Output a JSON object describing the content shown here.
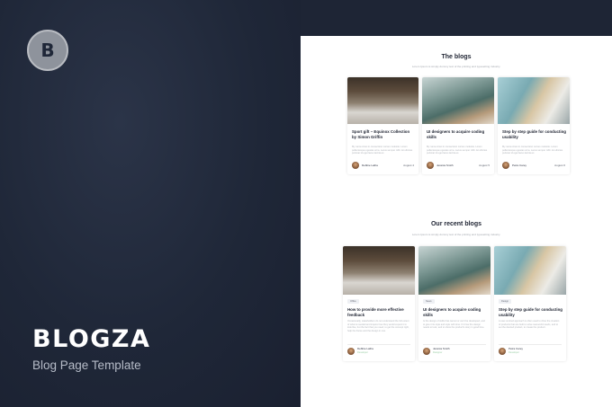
{
  "brand": {
    "logo_letter": "B",
    "name": "BLOGZA",
    "tagline": "Blog Page Template"
  },
  "section1": {
    "title": "The blogs",
    "subtitle": "Lorem Ipsum is simply dummy text of the printing and typesetting industry.",
    "cards": [
      {
        "title": "Sport gift – Equinox Collection by Simon Griffin",
        "desc": "My name Amet in consectetur cursus molestie. Lorem pellentesque egestas urna. Lacus semper nibh. Et ultricies pulvinar id eget lacus lacinia et.",
        "author": "Debbie Latha",
        "date": "August 4"
      },
      {
        "title": "UI designers to acquire coding skills",
        "desc": "My name Amet in consectetur cursus molestie. Lorem pellentesque egestas urna. Lacus semper nibh. Et ultricies pulvinar id eget lacus lacinia et.",
        "author": "Jessica Smith",
        "date": "August 5"
      },
      {
        "title": "Step by step guide for conducting usability",
        "desc": "My name Amet in consectetur cursus molestie. Lorem pellentesque egestas urna. Lacus semper nibh. Et ultricies pulvinar id eget lacus lacinia et.",
        "author": "Petra Carey",
        "date": "August 6"
      }
    ]
  },
  "section2": {
    "title": "Our recent blogs",
    "subtitle": "Lorem Ipsum is simply dummy text of the printing and typesetting industry.",
    "cards": [
      {
        "tag": "Office",
        "title": "How to provide more effective feedback",
        "desc": "Occasionally, stakeholders do not understand the full extent of what is needed and inquire how they would expect it to look like, but the fact that you need, to get the concept right, help the frame and the design in one.",
        "author": "Debbie Latha",
        "role": "Developer"
      },
      {
        "tag": "News",
        "title": "UI designers to acquire coding skills",
        "desc": "Is the design of skills that cannot or can't be developed, and to give it its style and style with time. It's how the design needs to look, and to show the product's story in good time.",
        "author": "Jessica Smith",
        "role": "Designer"
      },
      {
        "tag": "Design",
        "title": "Step by step guide for conducting usability",
        "desc": "A user-centred approach is often used to drive the creation of products that are built to solve real-world needs, and to set the desired product, to create the product.",
        "author": "Petra Carey",
        "role": "Developer"
      }
    ]
  }
}
